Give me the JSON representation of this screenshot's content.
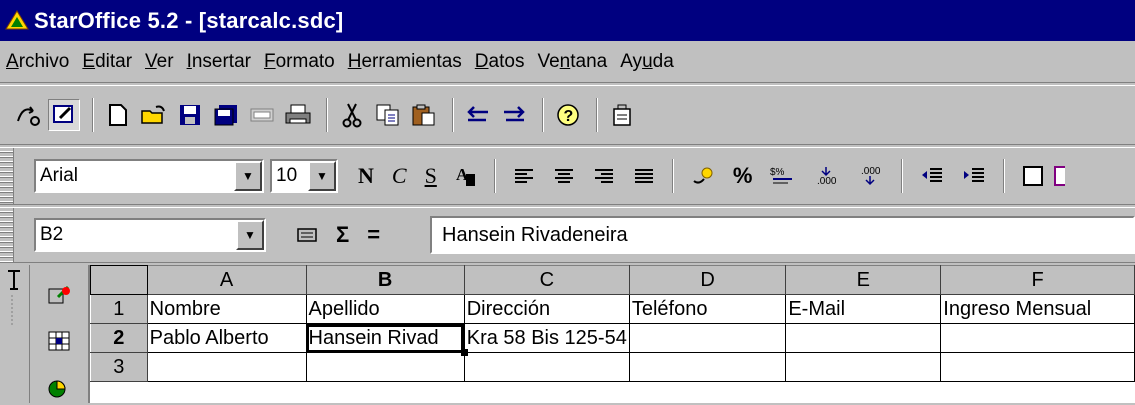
{
  "window": {
    "title": "StarOffice 5.2 - [starcalc.sdc]"
  },
  "menu": [
    {
      "pre": "",
      "u": "A",
      "post": "rchivo"
    },
    {
      "pre": "",
      "u": "E",
      "post": "ditar"
    },
    {
      "pre": "",
      "u": "V",
      "post": "er"
    },
    {
      "pre": "",
      "u": "I",
      "post": "nsertar"
    },
    {
      "pre": "",
      "u": "F",
      "post": "ormato"
    },
    {
      "pre": "",
      "u": "H",
      "post": "erramientas"
    },
    {
      "pre": "",
      "u": "D",
      "post": "atos"
    },
    {
      "pre": "Ve",
      "u": "n",
      "post": "tana"
    },
    {
      "pre": "Ay",
      "u": "u",
      "post": "da"
    }
  ],
  "format_toolbar": {
    "font": "Arial",
    "size": "10",
    "bold": "N",
    "italic": "C",
    "underline": "S"
  },
  "formula_bar": {
    "cell_ref": "B2",
    "sum": "Σ",
    "equals": "=",
    "content": "Hansein Rivadeneira"
  },
  "sheet": {
    "columns": [
      "A",
      "B",
      "C",
      "D",
      "E",
      "F"
    ],
    "rows": [
      {
        "num": "1",
        "cells": [
          "Nombre",
          "Apellido",
          "Dirección",
          "Teléfono",
          "E-Mail",
          "Ingreso Mensual"
        ]
      },
      {
        "num": "2",
        "cells": [
          "Pablo Alberto",
          "Hansein Rivad",
          "Kra 58 Bis 125-54",
          "",
          "",
          ""
        ]
      },
      {
        "num": "3",
        "cells": [
          "",
          "",
          "",
          "",
          "",
          ""
        ]
      }
    ]
  }
}
